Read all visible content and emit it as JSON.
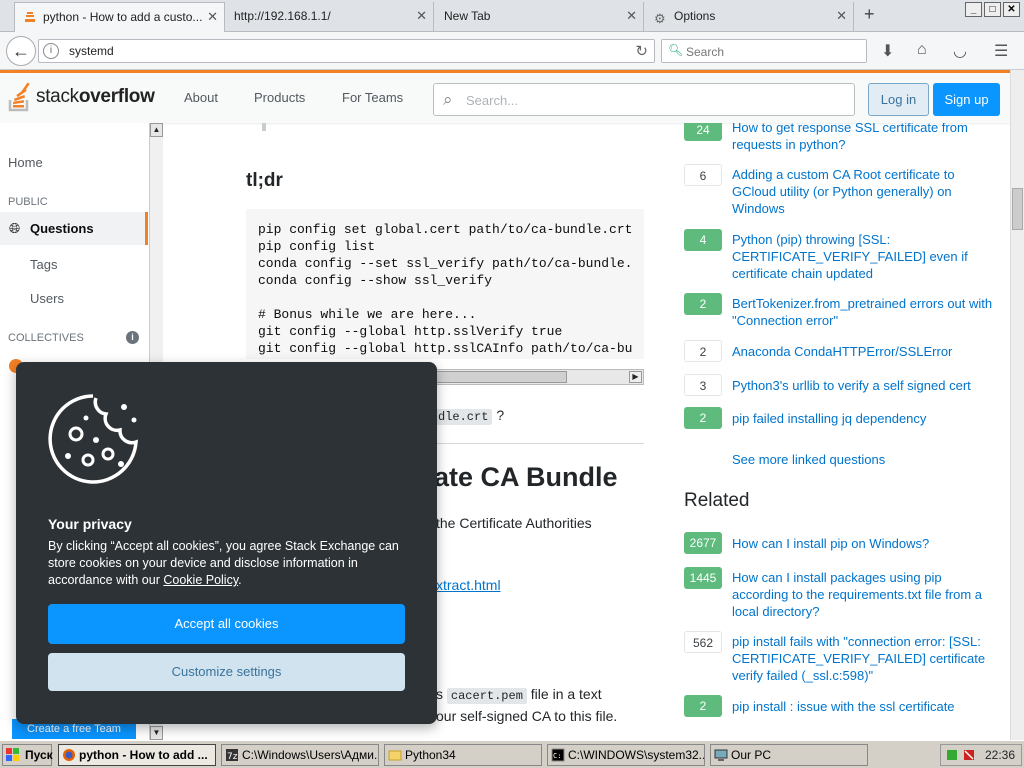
{
  "browser": {
    "tabs": [
      {
        "label": "python - How to add a custo..."
      },
      {
        "label": "http://192.168.1.1/"
      },
      {
        "label": "New Tab"
      },
      {
        "label": "Options"
      }
    ],
    "new_tab": "+",
    "url": "systemd",
    "search_placeholder": "Search"
  },
  "header": {
    "logo_text_1": "stack",
    "logo_text_2": "overflow",
    "nav": [
      "About",
      "Products",
      "For Teams"
    ],
    "search_placeholder": "Search...",
    "login": "Log in",
    "signup": "Sign up"
  },
  "sidebar": {
    "home": "Home",
    "public_head": "PUBLIC",
    "questions": "Questions",
    "tags": "Tags",
    "users": "Users",
    "collectives_head": "COLLECTIVES",
    "create_team": "Create a free Team"
  },
  "main": {
    "heading_tldr": "tl;dr",
    "code_lines": "pip config set global.cert path/to/ca-bundle.crt\npip config list\nconda config --set ssl_verify path/to/ca-bundle.\nconda config --show ssl_verify\n\n# Bonus while we are here...\ngit config --global http.sslVerify true\ngit config --global http.sslCAInfo path/to/ca-bu",
    "para1_code": "dle.crt",
    "para1_tail": "?",
    "heading2": "ate CA Bundle",
    "para2": "the Certificate Authorities",
    "link1": "xtract.html",
    "para3_code": "cacert.pem",
    "para3_a": "s",
    "para3_b": "file in a text",
    "para4": "our self-signed CA to this file."
  },
  "linked": [
    {
      "votes": "24",
      "answered": true,
      "title": "How to get response SSL certificate from requests in python?"
    },
    {
      "votes": "6",
      "answered": false,
      "title": "Adding a custom CA Root certificate to GCloud utility (or Python generally) on Windows"
    },
    {
      "votes": "4",
      "answered": true,
      "title": "Python (pip) throwing [SSL: CERTIFICATE_VERIFY_FAILED] even if certificate chain updated"
    },
    {
      "votes": "2",
      "answered": true,
      "title": "BertTokenizer.from_pretrained errors out with \"Connection error\""
    },
    {
      "votes": "2",
      "answered": false,
      "title": "Anaconda CondaHTTPError/SSLError"
    },
    {
      "votes": "3",
      "answered": false,
      "title": "Python3's urllib to verify a self signed cert"
    },
    {
      "votes": "2",
      "answered": true,
      "title": "pip failed installing jq dependency"
    }
  ],
  "see_more": "See more linked questions",
  "related_title": "Related",
  "related": [
    {
      "votes": "2677",
      "answered": true,
      "title": "How can I install pip on Windows?"
    },
    {
      "votes": "1445",
      "answered": true,
      "title": "How can I install packages using pip according to the requirements.txt file from a local directory?"
    },
    {
      "votes": "562",
      "answered": false,
      "title": "pip install fails with \"connection error: [SSL: CERTIFICATE_VERIFY_FAILED] certificate verify failed (_ssl.c:598)\""
    },
    {
      "votes": "2",
      "answered": true,
      "title": "pip install : issue with the ssl certificate"
    }
  ],
  "cookie": {
    "title": "Your privacy",
    "body": "By clicking “Accept all cookies”, you agree Stack Exchange can store cookies on your device and disclose information in accordance with our",
    "policy_link": "Cookie Policy",
    "period": ".",
    "accept": "Accept all cookies",
    "customize": "Customize settings"
  },
  "taskbar": {
    "start": "Пуск",
    "tasks": [
      "python - How to add ...",
      "C:\\Windows\\Users\\Адми...",
      "Python34",
      "C:\\WINDOWS\\system32...",
      "Our PC"
    ],
    "clock": "22:36"
  },
  "colors": {
    "accent": "#f48024",
    "link": "#0074cc",
    "answered": "#5eba7d",
    "primary_button": "#0a95ff"
  }
}
